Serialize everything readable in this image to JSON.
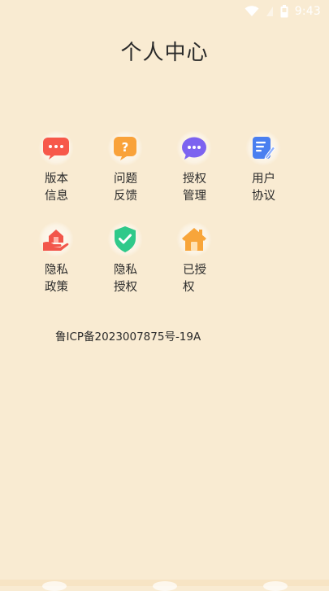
{
  "status_bar": {
    "time": "9:43",
    "icons": [
      "wifi-icon",
      "signal-icon",
      "battery-icon"
    ]
  },
  "header": {
    "title": "个人中心"
  },
  "menu": {
    "items": [
      {
        "label": "版本信息",
        "icon": "chat-bubble-icon",
        "color": "#f7584a"
      },
      {
        "label": "问题反馈",
        "icon": "question-bubble-icon",
        "color": "#f9a23a"
      },
      {
        "label": "授权管理",
        "icon": "message-dots-icon",
        "color": "#7c63f0"
      },
      {
        "label": "用户协议",
        "icon": "document-edit-icon",
        "color": "#4a7ff0"
      },
      {
        "label": "隐私政策",
        "icon": "hand-house-icon",
        "color": "#f2564b"
      },
      {
        "label": "隐私授权",
        "icon": "shield-check-icon",
        "color": "#2fc98a"
      },
      {
        "label": "已授权",
        "icon": "house-icon",
        "color": "#f8a53a"
      }
    ]
  },
  "footer": {
    "icp": "鲁ICP备2023007875号-19A"
  }
}
